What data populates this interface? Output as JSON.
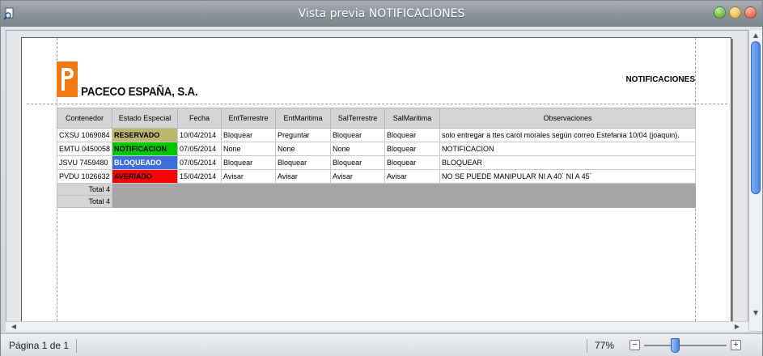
{
  "window": {
    "title": "Vista previa NOTIFICACIONES",
    "icon": "print-preview-icon"
  },
  "report": {
    "company": "PACECO ESPAÑA, S.A.",
    "title": "NOTIFICACIONES",
    "columns": [
      "Contenedor",
      "Estado Especial",
      "Fecha",
      "EntTerrestre",
      "EntMaritima",
      "SalTerrestre",
      "SalMaritima",
      "Observaciones"
    ],
    "rows": [
      {
        "contenedor": "CXSU 1069084",
        "estado": "RESERVADO",
        "estado_color": "#bdb76b",
        "estado_text_color": "#000000",
        "fecha": "10/04/2014",
        "ent_terrestre": "Bloquear",
        "ent_maritima": "Preguntar",
        "sal_terrestre": "Bloquear",
        "sal_maritima": "Bloquear",
        "observaciones": "solo entregar a ttes carol morales según correo Estefania 10/04 (joaquin)."
      },
      {
        "contenedor": "EMTU 0450058",
        "estado": "NOTIFICACION",
        "estado_color": "#00c800",
        "estado_text_color": "#000000",
        "fecha": "07/05/2014",
        "ent_terrestre": "None",
        "ent_maritima": "None",
        "sal_terrestre": "None",
        "sal_maritima": "Bloquear",
        "observaciones": "NOTIFICACION"
      },
      {
        "contenedor": "JSVU 7459480",
        "estado": "BLOQUEADO",
        "estado_color": "#3c6cde",
        "estado_text_color": "#ffffff",
        "fecha": "07/05/2014",
        "ent_terrestre": "Bloquear",
        "ent_maritima": "Bloquear",
        "sal_terrestre": "Bloquear",
        "sal_maritima": "Bloquear",
        "observaciones": "BLOQUEAR"
      },
      {
        "contenedor": "PVDU 1026632",
        "estado": "AVERIADO",
        "estado_color": "#ff0000",
        "estado_text_color": "#000000",
        "fecha": "15/04/2014",
        "ent_terrestre": "Avisar",
        "ent_maritima": "Avisar",
        "sal_terrestre": "Avisar",
        "sal_maritima": "Avisar",
        "observaciones": "NO SE PUEDE MANIPULAR NI A 40´ NI A 45´"
      }
    ],
    "totals": [
      "Total 4",
      "Total 4"
    ]
  },
  "status": {
    "page_label": "Página 1 de 1",
    "zoom": "77%",
    "zoom_level": 0.77
  }
}
